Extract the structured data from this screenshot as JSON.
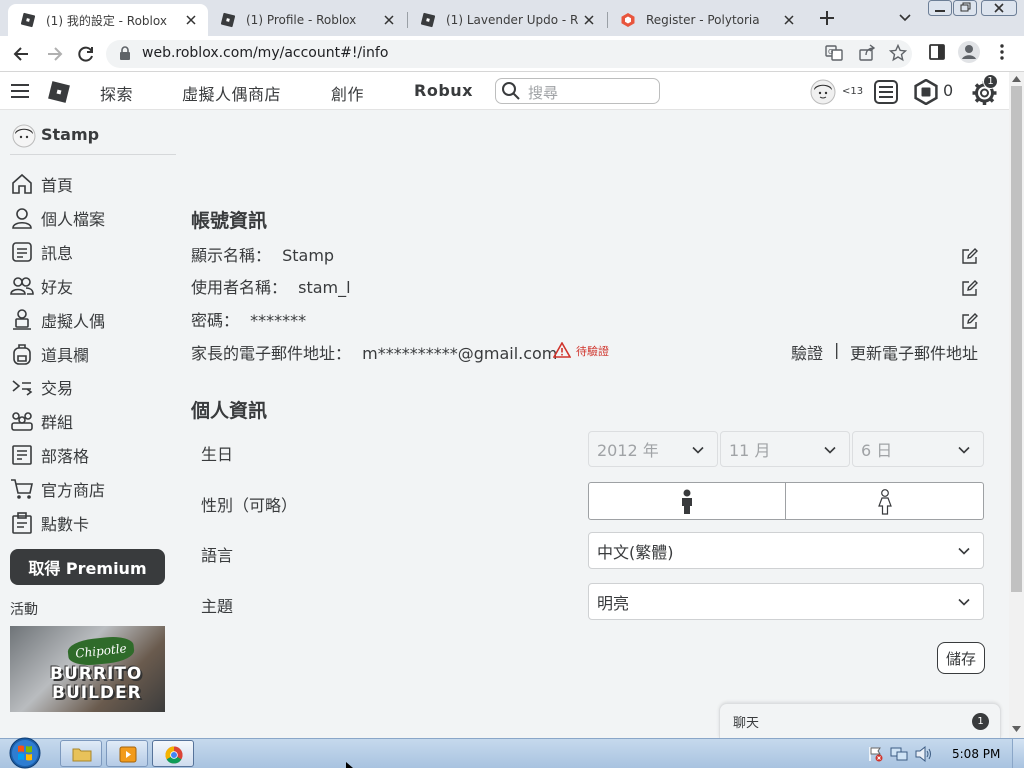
{
  "browser": {
    "tabs": [
      {
        "title": "(1) 我的設定 - Roblox",
        "active": true,
        "icon": "roblox-icon"
      },
      {
        "title": "(1) Profile - Roblox",
        "active": false,
        "icon": "roblox-icon"
      },
      {
        "title": "(1) Lavender Updo - Robl",
        "active": false,
        "icon": "roblox-icon"
      },
      {
        "title": "Register - Polytoria",
        "active": false,
        "icon": "polytoria-icon"
      }
    ],
    "url": "web.roblox.com/my/account#!/info"
  },
  "header": {
    "nav": [
      "探索",
      "虛擬人偶商店",
      "創作",
      "Robux"
    ],
    "search_placeholder": "搜尋",
    "age_label": "<13",
    "robux_count": "0",
    "settings_badge": "1"
  },
  "sidebar": {
    "username": "Stamp",
    "items": [
      "首頁",
      "個人檔案",
      "訊息",
      "好友",
      "虛擬人偶",
      "道具欄",
      "交易",
      "群組",
      "部落格",
      "官方商店",
      "點數卡"
    ],
    "premium_button": "取得 Premium",
    "events_label": "活動",
    "event_banner": {
      "brand": "Chipotle",
      "line1": "BURRITO",
      "line2": "BUILDER"
    }
  },
  "account": {
    "section_title": "帳號資訊",
    "display_name_label": "顯示名稱：",
    "display_name": "Stamp",
    "username_label": "使用者名稱：",
    "username": "stam_l",
    "password_label": "密碼：",
    "password": "*******",
    "parent_email_label": "家長的電子郵件地址：",
    "parent_email": "m**********@gmail.com",
    "pending_label": "待驗證",
    "verify_link": "驗證",
    "separator": "|",
    "update_email_link": "更新電子郵件地址"
  },
  "personal": {
    "section_title": "個人資訊",
    "birthday_label": "生日",
    "birth_year": "2012 年",
    "birth_month": "11 月",
    "birth_day": "6 日",
    "gender_label": "性別（可略）",
    "language_label": "語言",
    "language_value": "中文(繁體)",
    "theme_label": "主題",
    "theme_value": "明亮",
    "save_button": "儲存"
  },
  "chat": {
    "label": "聊天",
    "badge": "1"
  },
  "taskbar": {
    "time": "5:08 PM"
  }
}
